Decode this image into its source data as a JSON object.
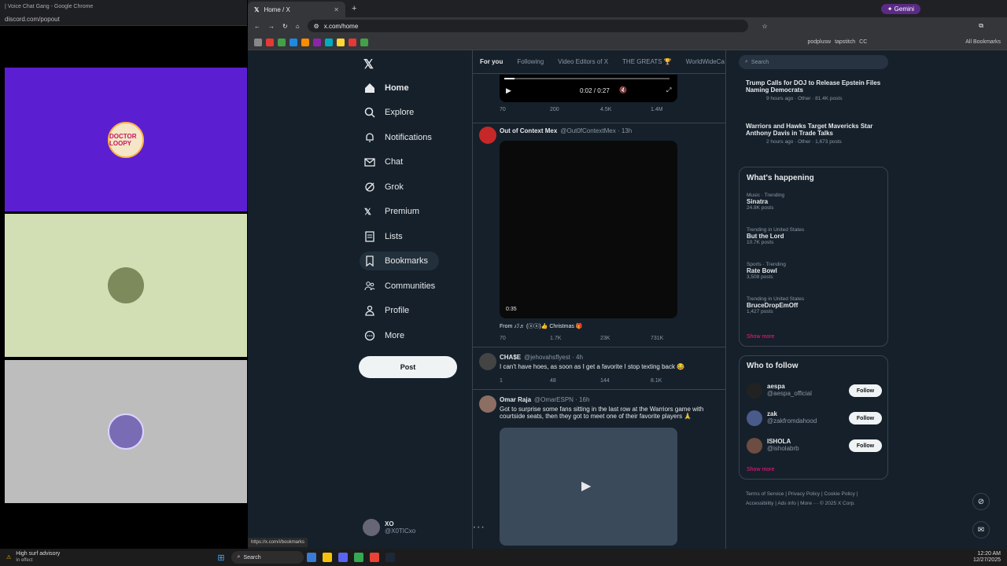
{
  "discord": {
    "title": "| Voice Chat Gang - Google Chrome",
    "url": "discord.com/popout",
    "tiles": [
      {
        "label": "DOCTOR LOOPY",
        "bg": "#5b1fd1"
      },
      {
        "label": "",
        "bg": "#d2dfb4"
      },
      {
        "label": "",
        "bg": "#bdbdbd"
      }
    ]
  },
  "chrome": {
    "tab_title": "Home / X",
    "url": "x.com/home",
    "gemini_label": "Gemini",
    "bookmarks_right": [
      "podplusw",
      "tapstitch",
      "CC"
    ],
    "all_bookmarks": "All Bookmarks",
    "status_url": "https://x.com/i/bookmarks"
  },
  "nav": {
    "items": [
      {
        "label": "Home",
        "icon": "home-icon"
      },
      {
        "label": "Explore",
        "icon": "search-icon"
      },
      {
        "label": "Notifications",
        "icon": "bell-icon"
      },
      {
        "label": "Chat",
        "icon": "mail-icon"
      },
      {
        "label": "Grok",
        "icon": "grok-icon"
      },
      {
        "label": "Premium",
        "icon": "x-icon"
      },
      {
        "label": "Lists",
        "icon": "list-icon"
      },
      {
        "label": "Bookmarks",
        "icon": "bookmark-icon"
      },
      {
        "label": "Communities",
        "icon": "people-icon"
      },
      {
        "label": "Profile",
        "icon": "person-icon"
      },
      {
        "label": "More",
        "icon": "more-circle-icon"
      }
    ],
    "post_label": "Post",
    "account": {
      "name": "XO",
      "handle": "@X0TICxo"
    }
  },
  "feed": {
    "tabs": [
      "For you",
      "Following",
      "Video Editors of X",
      "THE GREATS 🏆",
      "WorldWideCa"
    ],
    "video_time": "0:02 / 0:27",
    "tweet0_actions": {
      "replies": "70",
      "reposts": "200",
      "likes": "4.5K",
      "views": "1.4M"
    },
    "tweets": [
      {
        "name": "Out of Context Mex",
        "handle": "@Out0fContextMex · 13h",
        "video_duration": "0:35",
        "from": "From ♪ℐ♬ (ⓧⓧ)👍 Christmas 🎁",
        "actions": {
          "replies": "70",
          "reposts": "1.7K",
          "likes": "23K",
          "views": "731K"
        }
      },
      {
        "name": "CHA$E",
        "handle": "@jehovahsflyest · 4h",
        "text": "I can't have hoes, as soon as I get a favorite I stop texting back 😂",
        "actions": {
          "replies": "1",
          "reposts": "48",
          "likes": "144",
          "views": "8.1K"
        }
      },
      {
        "name": "Omar Raja",
        "handle": "@OmarESPN · 16h",
        "text": "Got to surprise some fans sitting in the last row at the Warriors game with courtside seats, then they got to meet one of their favorite players 🙏"
      }
    ]
  },
  "sidebar": {
    "search_placeholder": "Search",
    "news": [
      {
        "title": "Trump Calls for DOJ to Release Epstein Files Naming Democrats",
        "meta": "9 hours ago · Other · 81.4K posts"
      },
      {
        "title": "Warriors and Hawks Target Mavericks Star Anthony Davis in Trade Talks",
        "meta": "2 hours ago · Other · 1,673 posts"
      }
    ],
    "happening_title": "What's happening",
    "trends": [
      {
        "context": "Music · Trending",
        "name": "Sinatra",
        "posts": "24.8K posts"
      },
      {
        "context": "Trending in United States",
        "name": "But the Lord",
        "posts": "10.7K posts"
      },
      {
        "context": "Sports · Trending",
        "name": "Rate Bowl",
        "posts": "3,508 posts"
      },
      {
        "context": "Trending in United States",
        "name": "BruceDropEmOff",
        "posts": "1,427 posts"
      }
    ],
    "show_more": "Show more",
    "who_to_follow_title": "Who to follow",
    "follow": [
      {
        "name": "aespa",
        "handle": "@aespa_official"
      },
      {
        "name": "zak",
        "handle": "@zakfromdahood"
      },
      {
        "name": "ISHOLA",
        "handle": "@isholabrb"
      }
    ],
    "follow_label": "Follow",
    "show_more2": "Show more",
    "footer": "Terms of Service | Privacy Policy | Cookie Policy | Accessibility | Ads info | More ··· © 2025 X Corp."
  },
  "taskbar": {
    "weather_title": "High surf advisory",
    "weather_sub": "In effect",
    "search": "Search",
    "time": "12:20 AM",
    "date": "12/27/2025"
  }
}
